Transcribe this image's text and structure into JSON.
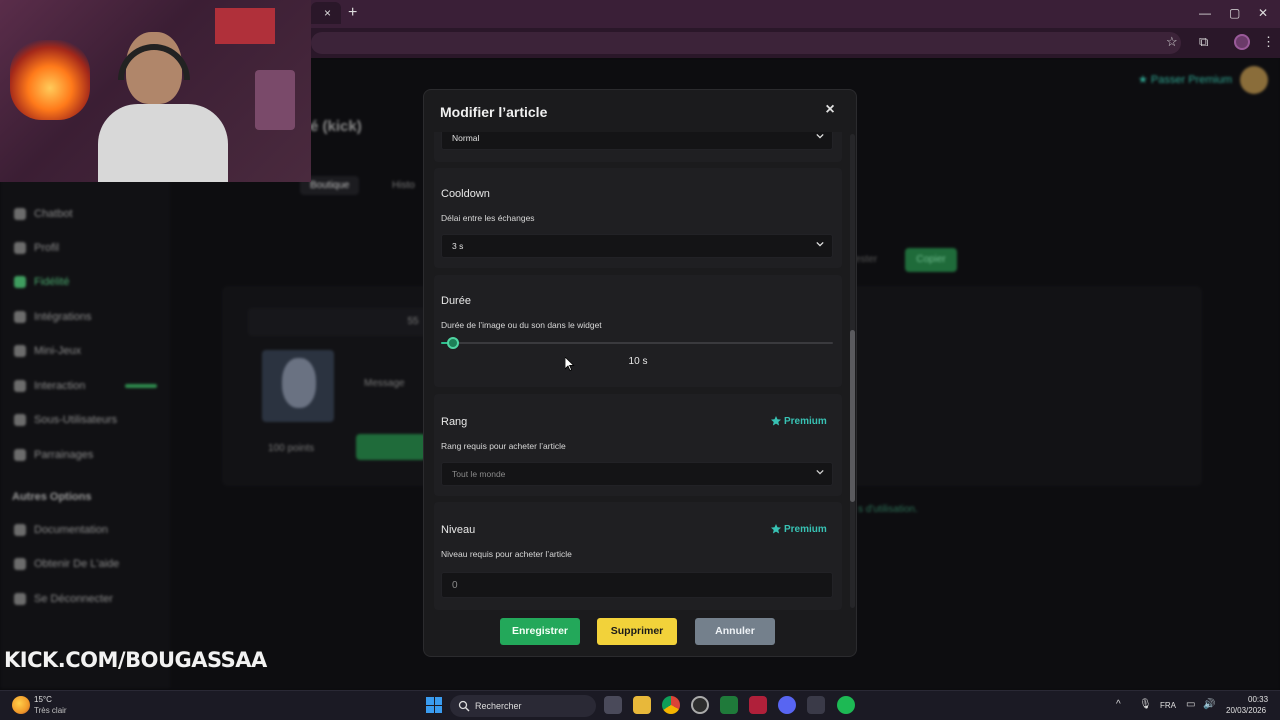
{
  "browser": {
    "tab_close": "×",
    "new_tab": "+",
    "window_controls": [
      "—",
      "▢",
      "✕"
    ]
  },
  "background_page": {
    "title": "é (kick)",
    "tabs": [
      "Boutique",
      "Histo"
    ],
    "premium_link": "★ Passer Premium",
    "sidebar": {
      "items": [
        {
          "label": "Chatbot",
          "active": false
        },
        {
          "label": "Profil",
          "active": false
        },
        {
          "label": "Fidélité",
          "active": true
        },
        {
          "label": "Intégrations",
          "active": false
        },
        {
          "label": "Mini-Jeux",
          "active": false
        },
        {
          "label": "Interaction",
          "active": false
        },
        {
          "label": "Sous-Utilisateurs",
          "active": false
        },
        {
          "label": "Parrainages",
          "active": false
        }
      ],
      "section_header": "Autres Options",
      "other_items": [
        "Documentation",
        "Obtenir De L'aide",
        "Se Déconnecter"
      ]
    },
    "card": {
      "strip_value": "55",
      "message_label": "Message",
      "points": "100 points"
    },
    "copy_button": "Copier",
    "ghost_button": "Tester",
    "terms_link": "s d'utilisation."
  },
  "modal": {
    "title": "Modifier l’article",
    "close_icon": "×",
    "sections": {
      "type": {
        "selected": "Normal"
      },
      "cooldown": {
        "title": "Cooldown",
        "subtitle": "Délai entre les échanges",
        "selected": "3 s"
      },
      "duree": {
        "title": "Durée",
        "subtitle": "Durée de l’image ou du son dans le widget",
        "slider_fraction": 0.03,
        "value_label": "10 s"
      },
      "rang": {
        "title": "Rang",
        "badge": "Premium",
        "subtitle": "Rang requis pour acheter l’article",
        "selected": "Tout le monde"
      },
      "niveau": {
        "title": "Niveau",
        "badge": "Premium",
        "subtitle": "Niveau requis pour acheter l’article",
        "value": "0"
      }
    },
    "buttons": {
      "save": "Enregistrer",
      "delete": "Supprimer",
      "cancel": "Annuler"
    }
  },
  "overlay": {
    "kick_url": "KICK.COM/BOUGASSAA"
  },
  "taskbar": {
    "weather_temp": "15°C",
    "weather_desc": "Très clair",
    "search_placeholder": "Rechercher",
    "language": "FRA",
    "time": "00:33",
    "date": "20/03/2026"
  },
  "colors": {
    "accent_green": "#23a85a",
    "premium_teal": "#38c2b4",
    "delete_yellow": "#f2d23a",
    "cancel_gray": "#74808c"
  }
}
